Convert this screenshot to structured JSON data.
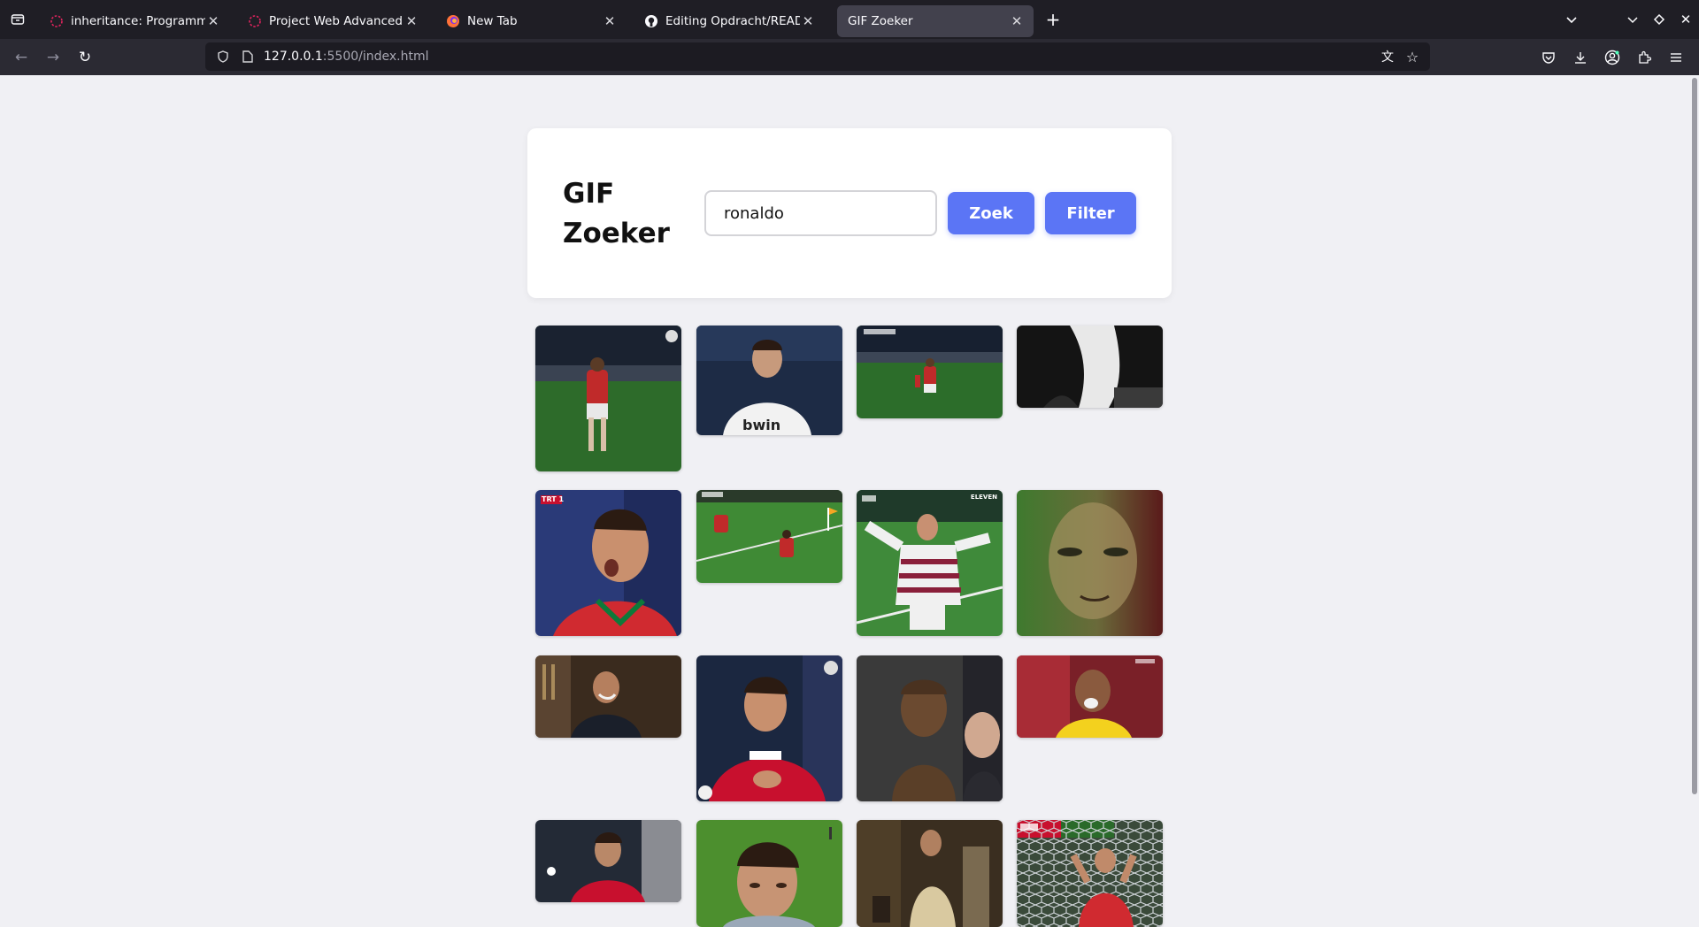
{
  "browser": {
    "tabs": [
      {
        "label": "inheritance: Programming",
        "favicon": "loading-icon",
        "active": false
      },
      {
        "label": "Project Web Advanced",
        "favicon": "loading-icon",
        "active": false
      },
      {
        "label": "New Tab",
        "favicon": "firefox-icon",
        "active": false
      },
      {
        "label": "Editing Opdracht/README",
        "favicon": "github-icon",
        "active": false
      },
      {
        "label": "GIF Zoeker",
        "favicon": "",
        "active": true
      }
    ],
    "url_host": "127.0.0.1",
    "url_path": ":5500/index.html"
  },
  "app": {
    "title": "GIF Zoeker",
    "search_value": "ronaldo",
    "zoek_label": "Zoek",
    "filter_label": "Filter",
    "accent_color": "#5b75f5"
  },
  "gifs": {
    "labels": [
      "TRT 1",
      "ELEVEN"
    ]
  }
}
